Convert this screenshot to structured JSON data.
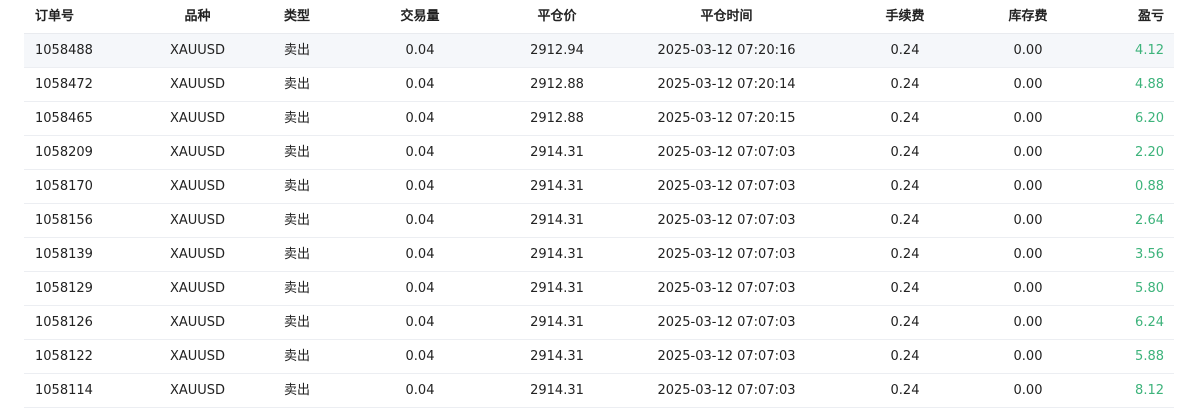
{
  "table": {
    "headers": {
      "order": "订单号",
      "symbol": "品种",
      "type": "类型",
      "volume": "交易量",
      "close_price": "平仓价",
      "close_time": "平仓时间",
      "fee": "手续费",
      "swap": "库存费",
      "pl": "盈亏"
    },
    "rows": [
      {
        "order": "1058488",
        "symbol": "XAUUSD",
        "type": "卖出",
        "volume": "0.04",
        "close_price": "2912.94",
        "close_time": "2025-03-12 07:20:16",
        "fee": "0.24",
        "swap": "0.00",
        "pl": "4.12"
      },
      {
        "order": "1058472",
        "symbol": "XAUUSD",
        "type": "卖出",
        "volume": "0.04",
        "close_price": "2912.88",
        "close_time": "2025-03-12 07:20:14",
        "fee": "0.24",
        "swap": "0.00",
        "pl": "4.88"
      },
      {
        "order": "1058465",
        "symbol": "XAUUSD",
        "type": "卖出",
        "volume": "0.04",
        "close_price": "2912.88",
        "close_time": "2025-03-12 07:20:15",
        "fee": "0.24",
        "swap": "0.00",
        "pl": "6.20"
      },
      {
        "order": "1058209",
        "symbol": "XAUUSD",
        "type": "卖出",
        "volume": "0.04",
        "close_price": "2914.31",
        "close_time": "2025-03-12 07:07:03",
        "fee": "0.24",
        "swap": "0.00",
        "pl": "2.20"
      },
      {
        "order": "1058170",
        "symbol": "XAUUSD",
        "type": "卖出",
        "volume": "0.04",
        "close_price": "2914.31",
        "close_time": "2025-03-12 07:07:03",
        "fee": "0.24",
        "swap": "0.00",
        "pl": "0.88"
      },
      {
        "order": "1058156",
        "symbol": "XAUUSD",
        "type": "卖出",
        "volume": "0.04",
        "close_price": "2914.31",
        "close_time": "2025-03-12 07:07:03",
        "fee": "0.24",
        "swap": "0.00",
        "pl": "2.64"
      },
      {
        "order": "1058139",
        "symbol": "XAUUSD",
        "type": "卖出",
        "volume": "0.04",
        "close_price": "2914.31",
        "close_time": "2025-03-12 07:07:03",
        "fee": "0.24",
        "swap": "0.00",
        "pl": "3.56"
      },
      {
        "order": "1058129",
        "symbol": "XAUUSD",
        "type": "卖出",
        "volume": "0.04",
        "close_price": "2914.31",
        "close_time": "2025-03-12 07:07:03",
        "fee": "0.24",
        "swap": "0.00",
        "pl": "5.80"
      },
      {
        "order": "1058126",
        "symbol": "XAUUSD",
        "type": "卖出",
        "volume": "0.04",
        "close_price": "2914.31",
        "close_time": "2025-03-12 07:07:03",
        "fee": "0.24",
        "swap": "0.00",
        "pl": "6.24"
      },
      {
        "order": "1058122",
        "symbol": "XAUUSD",
        "type": "卖出",
        "volume": "0.04",
        "close_price": "2914.31",
        "close_time": "2025-03-12 07:07:03",
        "fee": "0.24",
        "swap": "0.00",
        "pl": "5.88"
      },
      {
        "order": "1058114",
        "symbol": "XAUUSD",
        "type": "卖出",
        "volume": "0.04",
        "close_price": "2914.31",
        "close_time": "2025-03-12 07:07:03",
        "fee": "0.24",
        "swap": "0.00",
        "pl": "8.12"
      }
    ]
  },
  "colors": {
    "profit": "#3db37b",
    "highlight_row": "#f5f7fa"
  }
}
